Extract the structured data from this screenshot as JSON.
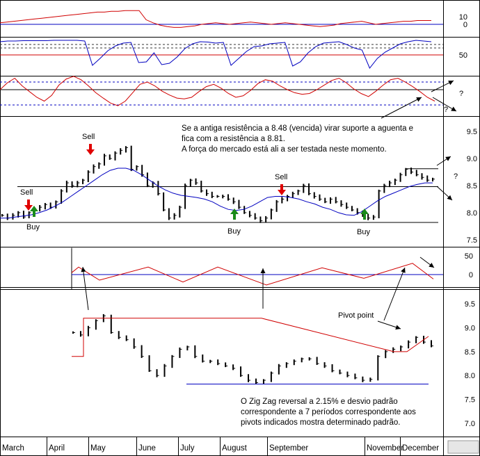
{
  "chart_data": [
    {
      "type": "line",
      "panel": "indicator-1",
      "yticks": [
        "10",
        "0"
      ],
      "series": [
        {
          "color": "#d00000",
          "values": [
            2,
            3,
            4,
            5,
            6,
            7,
            8,
            9,
            10,
            11,
            12,
            13,
            14,
            15,
            16,
            16,
            17,
            17,
            18,
            18,
            18,
            6,
            2,
            -1,
            -3,
            -4,
            -4,
            -3,
            -2,
            0,
            1,
            2,
            1,
            0,
            1,
            2,
            3,
            2,
            1,
            0,
            1,
            2,
            1,
            0,
            -1,
            -2,
            -3,
            -2,
            -1,
            1,
            2,
            3,
            4,
            2,
            0,
            1,
            2,
            3,
            4,
            4,
            5,
            5,
            5
          ]
        }
      ],
      "reference_lines": [
        {
          "value": 0,
          "color": "#0000c0"
        }
      ]
    },
    {
      "type": "line",
      "panel": "indicator-2",
      "yticks": [
        "50"
      ],
      "series": [
        {
          "color": "#0000c0",
          "values": [
            88,
            90,
            90,
            91,
            91,
            91,
            91,
            92,
            92,
            92,
            92,
            90,
            20,
            40,
            62,
            76,
            84,
            86,
            28,
            30,
            56,
            22,
            26,
            44,
            68,
            82,
            88,
            87,
            84,
            86,
            20,
            40,
            60,
            74,
            76,
            82,
            84,
            86,
            18,
            30,
            56,
            74,
            84,
            86,
            88,
            80,
            70,
            64,
            12,
            40,
            58,
            70,
            82,
            88,
            92,
            90,
            88
          ]
        }
      ],
      "reference_lines": [
        {
          "value": 80,
          "color": "#333333",
          "dashed": true
        },
        {
          "value": 70,
          "color": "#333333",
          "dashed": true
        },
        {
          "value": 50,
          "color": "#d00000"
        }
      ]
    },
    {
      "type": "line",
      "panel": "indicator-3",
      "annotations": [
        "?",
        "?"
      ],
      "series": [
        {
          "color": "#d00000",
          "values": [
            60,
            78,
            90,
            70,
            55,
            40,
            30,
            45,
            72,
            88,
            95,
            86,
            70,
            52,
            38,
            25,
            18,
            30,
            52,
            74,
            80,
            70,
            56,
            46,
            38,
            36,
            40,
            55,
            68,
            74,
            64,
            50,
            40,
            44,
            58,
            76,
            86,
            82,
            70,
            60,
            52,
            48,
            50,
            60,
            72,
            84,
            90,
            78,
            62,
            50,
            42,
            56,
            72,
            86,
            90,
            80,
            68,
            55,
            40,
            30
          ]
        }
      ],
      "reference_lines": [
        {
          "value": 80,
          "color": "#0000c0",
          "dashed": true
        },
        {
          "value": 60,
          "color": "#000000"
        },
        {
          "value": 20,
          "color": "#0000c0",
          "dashed": true
        }
      ]
    },
    {
      "type": "line",
      "panel": "price",
      "yticks": [
        "9.5",
        "9.0",
        "8.5",
        "8.0",
        "7.5"
      ],
      "ylim": [
        7.37,
        9.77
      ],
      "annotations": [
        "Sell",
        "Sell",
        "Sell",
        "Buy",
        "Buy",
        "Buy",
        "?",
        "Se a antiga resistência a 8.48 (vencida) virar suporte a aguenta e\nfica com a resistência a 8.81.\nA força do mercado está ali a ser testada neste momento."
      ],
      "series": [
        {
          "color": "#000000",
          "values": [
            7.95,
            7.9,
            7.95,
            8.0,
            7.92,
            8.0,
            8.05,
            8.1,
            8.15,
            8.1,
            8.2,
            8.4,
            8.55,
            8.5,
            8.55,
            8.6,
            8.75,
            8.85,
            8.9,
            9.05,
            9.0,
            9.1,
            9.15,
            9.2,
            8.8,
            8.85,
            8.7,
            8.5,
            8.55,
            8.35,
            8.05,
            7.9,
            7.95,
            8.1,
            8.5,
            8.6,
            8.55,
            8.4,
            8.35,
            8.3,
            8.3,
            8.3,
            8.25,
            8.2,
            8.1,
            8.0,
            7.95,
            7.9,
            7.85,
            7.9,
            8.05,
            8.2,
            8.25,
            8.3,
            8.35,
            8.4,
            8.5,
            8.35,
            8.3,
            8.25,
            8.2,
            8.25,
            8.2,
            8.15,
            8.1,
            8.05,
            8.0,
            7.95,
            7.9,
            7.92,
            8.4,
            8.5,
            8.55,
            8.6,
            8.7,
            8.8,
            8.75,
            8.7,
            8.65,
            8.6,
            8.62
          ]
        },
        {
          "color": "#0000c0",
          "values": [
            7.9,
            7.9,
            7.92,
            7.94,
            7.96,
            8.0,
            8.05,
            8.12,
            8.2,
            8.3,
            8.4,
            8.5,
            8.6,
            8.7,
            8.78,
            8.82,
            8.82,
            8.78,
            8.7,
            8.6,
            8.5,
            8.42,
            8.36,
            8.32,
            8.3,
            8.28,
            8.25,
            8.2,
            8.12,
            8.06,
            8.04,
            8.06,
            8.12,
            8.2,
            8.28,
            8.3,
            8.3,
            8.28,
            8.25,
            8.2,
            8.16,
            8.1,
            8.06,
            8.0,
            7.96,
            7.95,
            8.02,
            8.12,
            8.22,
            8.3,
            8.36,
            8.42,
            8.48,
            8.52,
            8.55,
            8.55
          ]
        }
      ],
      "reference_lines": [
        {
          "value": 8.81,
          "color": "#000000"
        },
        {
          "value": 8.48,
          "color": "#000000"
        },
        {
          "value": 7.82,
          "color": "#000000"
        }
      ]
    },
    {
      "type": "line",
      "panel": "zigzag-oscillator",
      "yticks": [
        "50",
        "0"
      ],
      "ylim": [
        -28,
        65
      ],
      "series": [
        {
          "color": "#d00000",
          "points": [
            [
              0,
              5
            ],
            [
              10,
              20
            ],
            [
              40,
              -15
            ],
            [
              110,
              20
            ],
            [
              160,
              -20
            ],
            [
              210,
              20
            ],
            [
              280,
              -28
            ],
            [
              360,
              18
            ],
            [
              420,
              -10
            ],
            [
              490,
              30
            ],
            [
              520,
              -12
            ]
          ]
        }
      ],
      "reference_lines": [
        {
          "value": 0,
          "color": "#0000c0"
        }
      ]
    },
    {
      "type": "line",
      "panel": "zigzag-price",
      "yticks": [
        "9.5",
        "9.0",
        "8.5",
        "8.0",
        "7.5",
        "7.0"
      ],
      "ylim": [
        6.75,
        9.78
      ],
      "annotations": [
        "Pivot point",
        "O Zig Zag reversal a 2.15% e desvio padrão\ncorrespondente a 7 períodos correspondente aos\npivots indicados mostra determinado padrão."
      ],
      "series": [
        {
          "color": "#000000",
          "values": [
            8.9,
            8.85,
            9.0,
            9.15,
            9.25,
            8.9,
            8.8,
            8.75,
            8.6,
            8.4,
            8.1,
            8.0,
            8.2,
            8.4,
            8.55,
            8.6,
            8.4,
            8.3,
            8.3,
            8.25,
            8.2,
            8.15,
            8.0,
            7.9,
            7.85,
            7.9,
            8.05,
            8.2,
            8.25,
            8.3,
            8.35,
            8.35,
            8.25,
            8.2,
            8.1,
            8.05,
            8.0,
            7.95,
            7.9,
            7.92,
            8.4,
            8.5,
            8.55,
            8.6,
            8.7,
            8.8,
            8.7,
            8.62
          ]
        },
        {
          "color": "#d00000",
          "values": [
            8.4,
            8.4,
            9.2,
            9.2,
            9.2,
            8.5,
            8.5,
            8.5,
            8.5,
            8.82,
            8.82
          ]
        },
        {
          "color": "#0000c0",
          "values": [
            7.82,
            7.82
          ]
        }
      ]
    }
  ],
  "x_axis": {
    "months": [
      "March",
      "April",
      "May",
      "June",
      "July",
      "August",
      "September",
      "November",
      "December"
    ]
  }
}
